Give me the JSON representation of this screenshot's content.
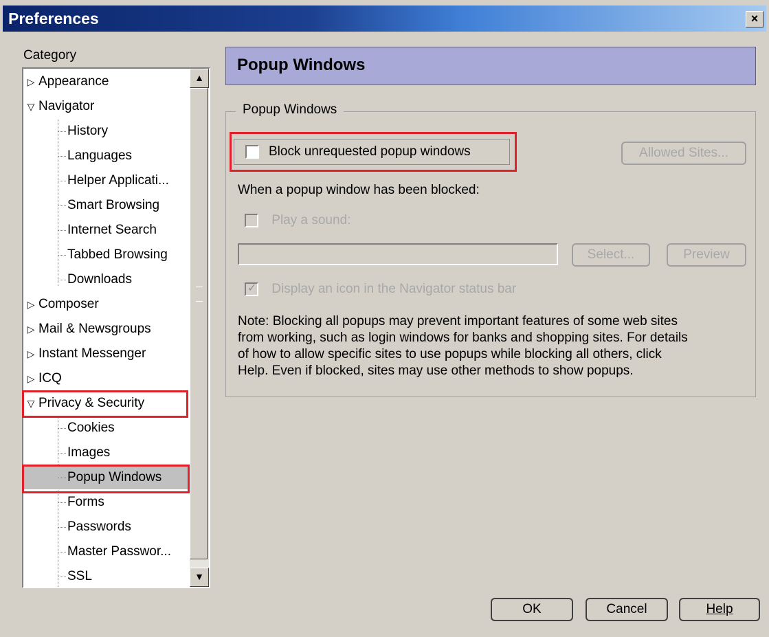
{
  "window": {
    "title": "Preferences",
    "close_glyph": "×"
  },
  "category": {
    "label": "Category",
    "items": [
      {
        "label": "Appearance",
        "expander": "▷"
      },
      {
        "label": "Navigator",
        "expander": "▽"
      },
      {
        "label": "History"
      },
      {
        "label": "Languages"
      },
      {
        "label": "Helper Applicati..."
      },
      {
        "label": "Smart Browsing"
      },
      {
        "label": "Internet Search"
      },
      {
        "label": "Tabbed Browsing"
      },
      {
        "label": "Downloads"
      },
      {
        "label": "Composer",
        "expander": "▷"
      },
      {
        "label": "Mail & Newsgroups",
        "expander": "▷"
      },
      {
        "label": "Instant Messenger",
        "expander": "▷"
      },
      {
        "label": "ICQ",
        "expander": "▷"
      },
      {
        "label": "Privacy & Security",
        "expander": "▽"
      },
      {
        "label": "Cookies"
      },
      {
        "label": "Images"
      },
      {
        "label": "Popup Windows",
        "selected": true
      },
      {
        "label": "Forms"
      },
      {
        "label": "Passwords"
      },
      {
        "label": "Master Passwor..."
      },
      {
        "label": "SSL"
      }
    ]
  },
  "panel": {
    "header": "Popup Windows",
    "group_legend": "Popup Windows",
    "block_checkbox": {
      "label": "Block unrequested popup windows",
      "checked": false
    },
    "allowed_sites_button": "Allowed Sites...",
    "when_blocked_label": "When a popup window has been blocked:",
    "play_sound_checkbox": {
      "label": "Play a sound:",
      "checked": false,
      "enabled": false
    },
    "sound_path_value": "",
    "select_button": "Select...",
    "preview_button": "Preview",
    "status_icon_checkbox": {
      "label": "Display an icon in the Navigator status bar",
      "checked": true,
      "enabled": false
    },
    "note_lines": [
      "Note: Blocking all popups may prevent important features of some web sites",
      "from working, such as login windows for banks and shopping sites. For details",
      "of how to allow specific sites to use popups while blocking all others, click",
      "Help. Even if blocked, sites may use other methods to show popups."
    ]
  },
  "footer": {
    "ok": "OK",
    "cancel": "Cancel",
    "help": "Help"
  },
  "colors": {
    "highlight": "#e0202a",
    "header_bg": "#a9a9d7",
    "dialog_bg": "#d4d0c8"
  }
}
